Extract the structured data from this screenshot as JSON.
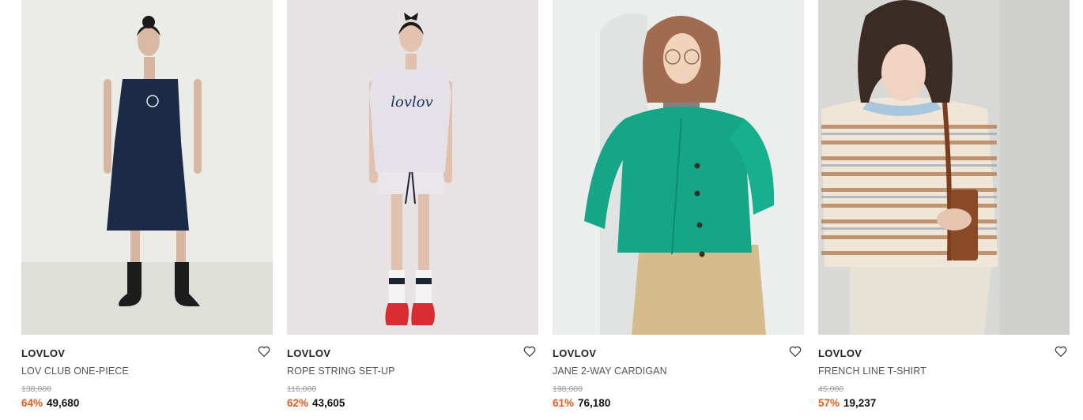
{
  "products": [
    {
      "brand": "LOVLOV",
      "name": "LOV CLUB ONE-PIECE",
      "original_price": "138,000",
      "discount": "64%",
      "price": "49,680",
      "image": "model-navy-slip-dress"
    },
    {
      "brand": "LOVLOV",
      "name": "ROPE STRING SET-UP",
      "original_price": "116,000",
      "discount": "62%",
      "price": "43,605",
      "image": "model-grey-vest-setup"
    },
    {
      "brand": "LOVLOV",
      "name": "JANE 2-WAY CARDIGAN",
      "original_price": "198,000",
      "discount": "61%",
      "price": "76,180",
      "image": "model-green-cardigan"
    },
    {
      "brand": "LOVLOV",
      "name": "FRENCH LINE T-SHIRT",
      "original_price": "45,000",
      "discount": "57%",
      "price": "19,237",
      "image": "model-striped-tshirt"
    }
  ],
  "colors": {
    "discount": "#f05a19",
    "price": "#111111",
    "original_price": "#9a9a9a"
  },
  "icons": {
    "wishlist": "heart-outline-icon"
  }
}
